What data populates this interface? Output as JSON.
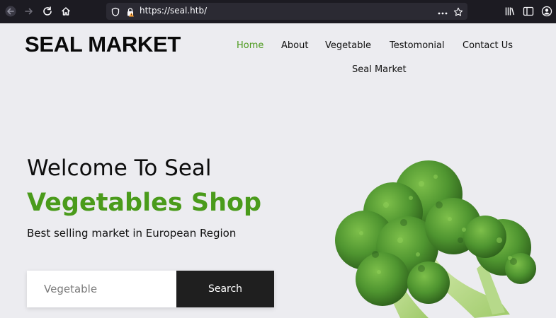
{
  "browser": {
    "url": "https://seal.htb/",
    "icons": {
      "back": "back-arrow-icon",
      "forward": "forward-arrow-icon",
      "reload": "reload-icon",
      "home": "home-icon",
      "shield": "shield-icon",
      "lock_warning": "lock-warning-icon",
      "more": "more-dots-icon",
      "bookmark": "star-icon",
      "library": "library-icon",
      "sidebar": "sidebar-icon",
      "account": "account-icon"
    }
  },
  "site": {
    "logo": "SEAL MARKET",
    "menu": [
      {
        "label": "Home",
        "active": true
      },
      {
        "label": "About",
        "active": false
      },
      {
        "label": "Vegetable",
        "active": false
      },
      {
        "label": "Testomonial",
        "active": false
      },
      {
        "label": "Contact Us",
        "active": false
      },
      {
        "label": "Seal Market",
        "active": false
      }
    ]
  },
  "hero": {
    "title_line1": "Welcome To Seal",
    "title_line2": "Vegetables Shop",
    "subtitle": "Best selling market in European Region",
    "search_placeholder": "Vegetable",
    "search_button": "Search",
    "image": "broccoli-image"
  },
  "colors": {
    "accent_green": "#4a9b1b",
    "page_bg": "#ececf0",
    "browser_bg": "#1c1b22",
    "search_button_bg": "#1f1f1f"
  }
}
